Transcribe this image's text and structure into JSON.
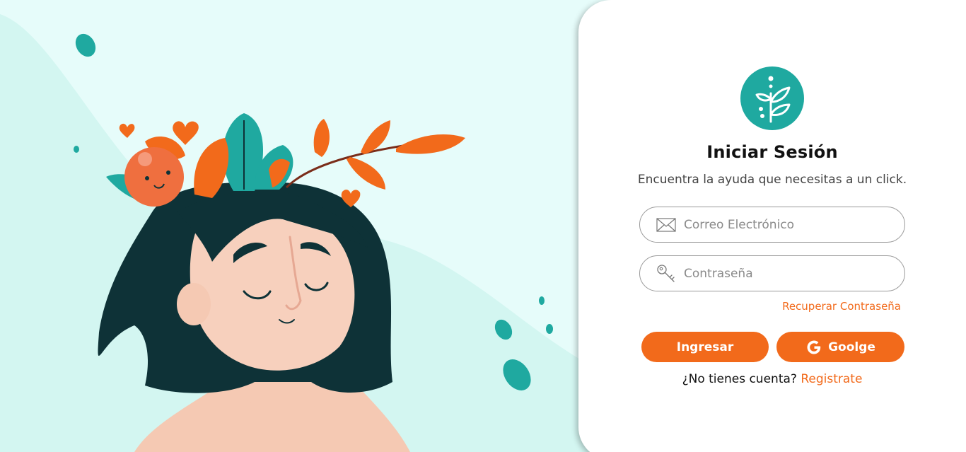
{
  "login": {
    "title": "Iniciar Sesión",
    "subtitle": "Encuentra la ayuda que necesitas a un click.",
    "email_placeholder": "Correo Electrónico",
    "password_placeholder": "Contraseña",
    "recover_link": "Recuperar Contraseña",
    "login_button": "Ingresar",
    "google_button": "Goolge",
    "no_account_text": "¿No tienes cuenta?",
    "register_link": "Registrate"
  },
  "icons": {
    "logo": "plant-icon",
    "email": "envelope-icon",
    "password": "key-icon",
    "google": "google-g-icon"
  },
  "colors": {
    "accent": "#f26a1b",
    "teal": "#1fa9a0",
    "background": "#e6fcfa"
  }
}
